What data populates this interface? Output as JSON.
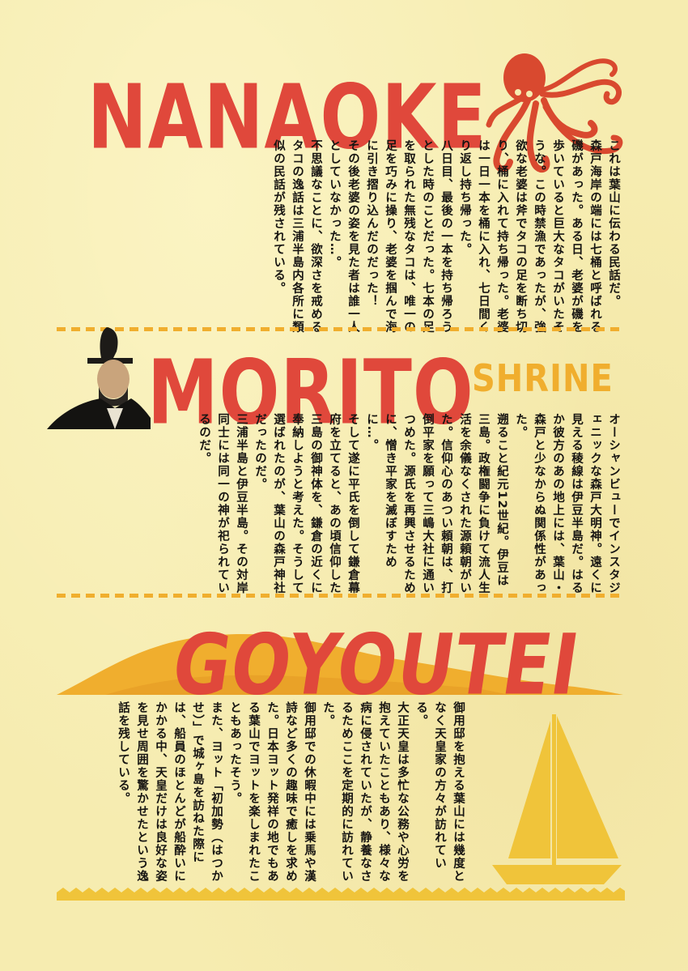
{
  "colors": {
    "paper": "#f6ecb0",
    "red": "#e0483b",
    "orange": "#f0ae2e",
    "ink": "#171512"
  },
  "sections": {
    "nanaoke": {
      "title": "NANAOKE",
      "icon": "octopus-icon",
      "text": "これは葉山に伝わる民話だ。\n森戸海岸の端には七桶と呼ばれる磯があった。ある日、老婆が磯を歩いていると巨大なタコがいたそうな。この時禁漁であったが、強欲な老婆は斧でタコの足を断ち切り、桶に入れて持ち帰った。老婆は一日一本を桶に入れ、七日間くり返し持ち帰った。\n八日目、最後の一本を持ち帰ろうとした時のことだった。七本の足を取られた無残なタコは、唯一の足を巧みに操り、老婆を掴んで海に引き摺り込んだのだった！\nその後老婆の姿を見た者は誰一人としていなかった…。\n不思議なことに、欲深さを戒めるタコの逸話は三浦半島内各所に類似の民話が残されている。"
    },
    "morito": {
      "title": "MORITO",
      "subtitle": "SHRINE",
      "icon": "samurai-portrait-icon",
      "text": "オーシャンビューでインスタジェニックな森戸大明神。遠くに見える稜線は伊豆半島だ。はるか彼方のあの地上には、葉山・森戸と少なからぬ関係性があった。\n遡ること紀元12世紀。伊豆は三島。政権闘争に負けて流人生活を余儀なくされた源頼朝がいた。信仰心のあつい頼朝は、打倒平家を願って三嶋大社に通いつめた。源氏を再興させるために、憎き平家を滅ぼすために…。\nそして遂に平氏を倒して鎌倉幕府を立てると、あの頃信仰した三島の御神体を、鎌倉の近くに奉納しようと考えた。そうして選ばれたのが、葉山の森戸神社だったのだ。\n三浦半島と伊豆半島。その対岸同士には同一の神が祀られているのだ。"
    },
    "goyoutei": {
      "title": "GOYOUTEI",
      "icon": "sailboat-icon",
      "text": "御用邸を抱える葉山には幾度となく天皇家の方々が訪れている。\n大正天皇は多忙な公務や心労を抱えていたこともあり、様々な病に侵されていたが、静養なさるためここを定期的に訪れていた。\n御用邸での休暇中には乗馬や漢詩など多くの趣味で癒しを求めた。日本ヨット発祥の地でもある葉山でヨットを楽しまれたこともあったそう。\nまた、ヨット「初加勢（はつかせ）」で城ヶ島を訪ねた際には、船員のほとんどが船酔いにかかる中、天皇だけは良好な姿を見せ周囲を驚かせたという逸話を残している。"
    }
  }
}
